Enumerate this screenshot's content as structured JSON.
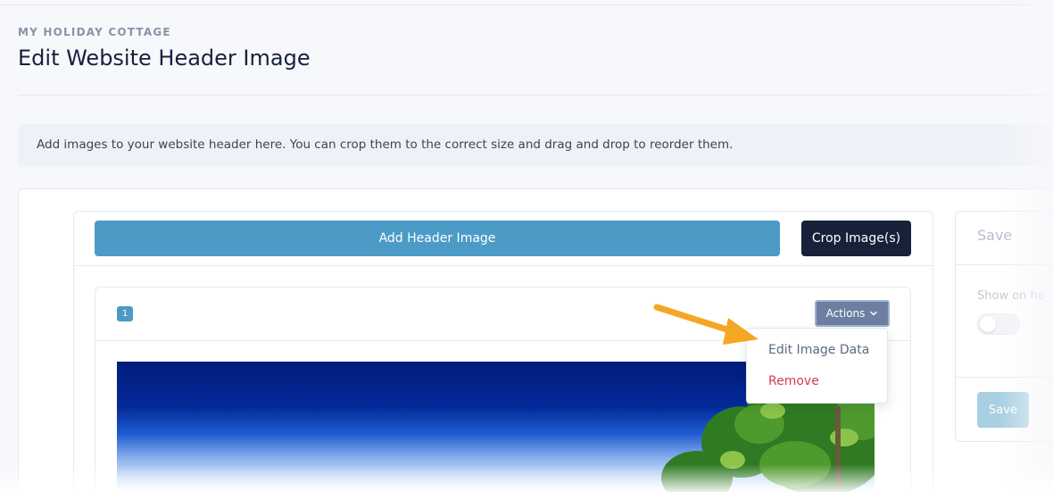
{
  "header": {
    "eyebrow": "MY HOLIDAY COTTAGE",
    "title": "Edit Website Header Image"
  },
  "info_text": "Add images to your website header here. You can crop them to the correct size and drag and drop to reorder them.",
  "toolbar": {
    "add_label": "Add Header Image",
    "crop_label": "Crop Image(s)"
  },
  "image_item": {
    "index": "1",
    "actions_label": "Actions",
    "menu": {
      "edit_label": "Edit Image Data",
      "remove_label": "Remove"
    }
  },
  "side_panel": {
    "title": "Save",
    "toggle_label": "Show on ho",
    "save_label": "Save"
  },
  "colors": {
    "primary": "#4b9bc6",
    "dark": "#17213a",
    "danger": "#d23b5c",
    "annotation_arrow": "#f5a623"
  }
}
